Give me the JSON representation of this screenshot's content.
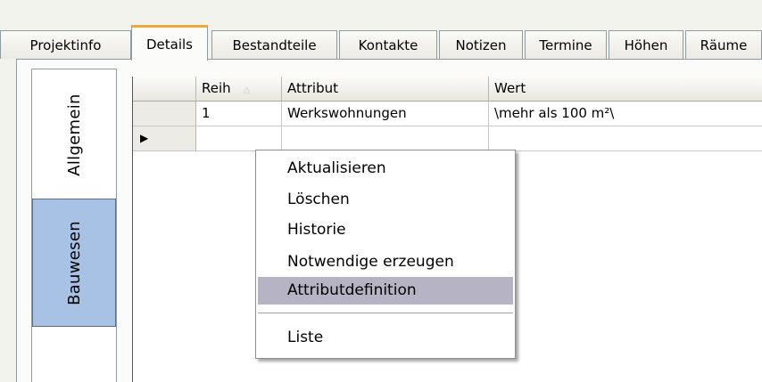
{
  "tabs": [
    {
      "label": "Projektinfo"
    },
    {
      "label": "Details"
    },
    {
      "label": "Bestandteile"
    },
    {
      "label": "Kontakte"
    },
    {
      "label": "Notizen"
    },
    {
      "label": "Termine"
    },
    {
      "label": "Höhen"
    },
    {
      "label": "Räume"
    }
  ],
  "side_tabs": [
    {
      "label": "Allgemein"
    },
    {
      "label": "Bauwesen"
    }
  ],
  "grid": {
    "columns": [
      "Reih",
      "Attribut",
      "Wert"
    ],
    "sort_indicator": "△",
    "rows": [
      [
        "1",
        "Werkswohnungen",
        "\\mehr als 100 m²\\"
      ],
      [
        "",
        "",
        ""
      ]
    ],
    "current_row_marker": "▶"
  },
  "context_menu": {
    "items": [
      {
        "label": "Aktualisieren"
      },
      {
        "label": "Löschen"
      },
      {
        "label": "Historie"
      },
      {
        "label": "Notwendige erzeugen"
      },
      {
        "label": "Attributdefinition",
        "highlighted": true
      },
      {
        "label": "Liste"
      }
    ]
  }
}
